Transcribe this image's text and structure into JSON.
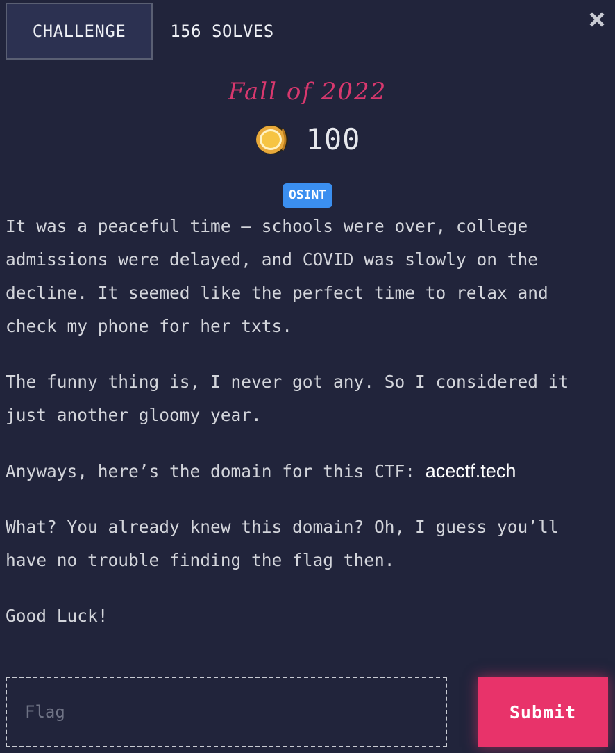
{
  "tabs": [
    {
      "label": "CHALLENGE",
      "active": true
    },
    {
      "label": "156 SOLVES",
      "active": false
    }
  ],
  "close_icon": "close-icon",
  "challenge": {
    "title": "Fall of 2022",
    "points": "100",
    "points_icon": "coin-icon",
    "category": "OSINT"
  },
  "description": {
    "p1": "It was a peaceful time — schools were over, college admissions were delayed, and COVID was slowly on the decline. It seemed like the perfect time to relax and check my phone for her txts.",
    "p2": "The funny thing is, I never got any. So I considered it just another gloomy year.",
    "p3_prefix": "Anyways, here’s the domain for this CTF: ",
    "p3_link": "acectf.tech",
    "p4": "What? You already knew this domain? Oh, I guess you’ll have no trouble finding the flag then.",
    "p5": "Good Luck!"
  },
  "flag_form": {
    "placeholder": "Flag",
    "value": "",
    "submit_label": "Submit"
  },
  "colors": {
    "background": "#21243b",
    "title": "#d8386e",
    "badge": "#3b8ff0",
    "submit": "#e8336a",
    "active_tab": "#2c3151"
  }
}
